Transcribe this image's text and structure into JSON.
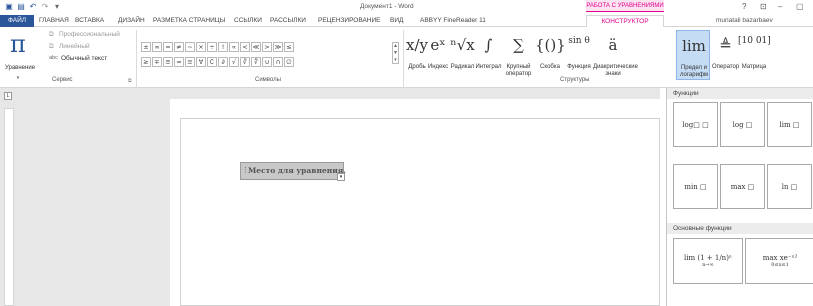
{
  "title": "Документ1 - Word",
  "context_tab_group": "РАБОТА С УРАВНЕНИЯМИ",
  "user": "munatali bazarbaev",
  "window_controls": [
    "?",
    "⊡",
    "–",
    "▢"
  ],
  "tabs": [
    "ФАЙЛ",
    "ГЛАВНАЯ",
    "ВСТАВКА",
    "ДИЗАЙН",
    "РАЗМЕТКА СТРАНИЦЫ",
    "ССЫЛКИ",
    "РАССЫЛКИ",
    "РЕЦЕНЗИРОВАНИЕ",
    "ВИД",
    "ABBYY FineReader 11",
    "КОНСТРУКТОР"
  ],
  "service": {
    "equation_label": "Уравнение",
    "professional": "Профессиональный",
    "linear": "Линейный",
    "plain_text": "Обычный текст",
    "group_label": "Сервис"
  },
  "symbols": {
    "row1": [
      "±",
      "∞",
      "=",
      "≠",
      "~",
      "×",
      "÷",
      "!",
      "∝",
      "<",
      "≪",
      ">",
      "≫",
      "≤"
    ],
    "row2": [
      "≥",
      "∓",
      "≅",
      "≈",
      "≡",
      "∀",
      "∁",
      "∂",
      "√",
      "∛",
      "∜",
      "∪",
      "∩",
      "∅"
    ],
    "group_label": "Символы"
  },
  "structures": {
    "items": [
      {
        "label": "Дробь",
        "glyph": "x/y"
      },
      {
        "label": "Индекс",
        "glyph": "eˣ"
      },
      {
        "label": "Радикал",
        "glyph": "ⁿ√x"
      },
      {
        "label": "Интеграл",
        "glyph": "∫"
      },
      {
        "label": "Крупный оператор",
        "glyph": "∑"
      },
      {
        "label": "Скобка",
        "glyph": "{()}"
      },
      {
        "label": "Функция",
        "glyph": "sin θ"
      },
      {
        "label": "Диакритические знаки",
        "glyph": "ä"
      },
      {
        "label": "Предел и логарифм",
        "glyph": "lim"
      },
      {
        "label": "Оператор",
        "glyph": "≜"
      },
      {
        "label": "Матрица",
        "glyph": "[10 01]"
      }
    ],
    "group_label": "Структуры"
  },
  "equation_placeholder": "Место для уравнения.",
  "gallery": {
    "header1": "Функции",
    "cells": [
      "log□ □",
      "log □",
      "lim □",
      "min □",
      "max □",
      "ln □"
    ],
    "header2": "Основные функции",
    "formula1": "lim (1 + 1/n)ⁿ",
    "formula1_sub": "n→∞",
    "formula2": "max xe⁻ˣ²",
    "formula2_sub": "0≤x≤1"
  },
  "colors": {
    "accent": "#2b579a",
    "context_tab": "#e3008c",
    "selected": "#c5dcf5"
  }
}
